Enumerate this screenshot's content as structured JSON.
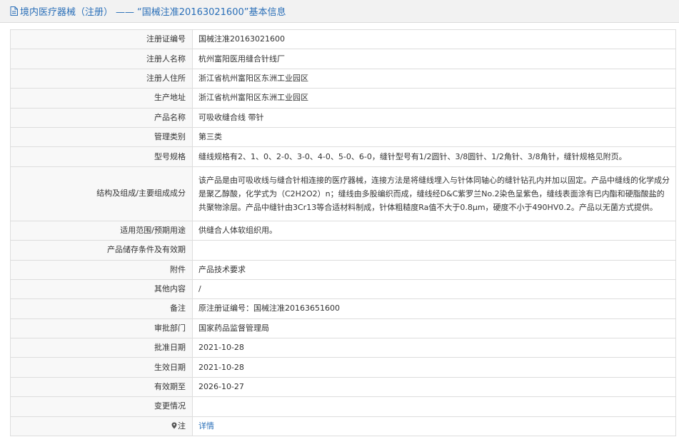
{
  "header": {
    "category": "境内医疗器械（注册）",
    "separator": "——",
    "reg_quoted": "“国械注准20163021600”",
    "suffix": "基本信息"
  },
  "rows": [
    {
      "label": "注册证编号",
      "value": "国械注准20163021600"
    },
    {
      "label": "注册人名称",
      "value": "杭州富阳医用缝合针线厂"
    },
    {
      "label": "注册人住所",
      "value": "浙江省杭州富阳区东洲工业园区"
    },
    {
      "label": "生产地址",
      "value": "浙江省杭州富阳区东洲工业园区"
    },
    {
      "label": "产品名称",
      "value": "可吸收缝合线 带针"
    },
    {
      "label": "管理类别",
      "value": "第三类"
    },
    {
      "label": "型号规格",
      "value": "缝线规格有2、1、0、2-0、3-0、4-0、5-0、6-0，缝针型号有1/2圆针、3/8圆针、1/2角针、3/8角针，缝针规格见附页。"
    },
    {
      "label": "结构及组成/主要组成成分",
      "value": "该产品是由可吸收线与缝合针相连接的医疗器械，连接方法是将缝线埋入与针体同轴心的缝针钻孔内并加以固定。产品中缝线的化学成分是聚乙醇酸，化学式为（C2H2O2）n；缝线由多股编织而成，缝线经D&C紫罗兰No.2染色呈紫色，缝线表面涂有已内酯和硬脂酸盐的共聚物涂层。产品中缝针由3Cr13等合适材料制成，针体粗糙度Ra值不大于0.8μm，硬度不小于490HV0.2。产品以无菌方式提供。"
    },
    {
      "label": "适用范围/预期用途",
      "value": "供缝合人体软组织用。"
    },
    {
      "label": "产品储存条件及有效期",
      "value": ""
    },
    {
      "label": "附件",
      "value": "产品技术要求"
    },
    {
      "label": "其他内容",
      "value": "/"
    },
    {
      "label": "备注",
      "value": "原注册证编号：国械注准20163651600"
    },
    {
      "label": "审批部门",
      "value": "国家药品监督管理局"
    },
    {
      "label": "批准日期",
      "value": "2021-10-28"
    },
    {
      "label": "生效日期",
      "value": "2021-10-28"
    },
    {
      "label": "有效期至",
      "value": "2026-10-27"
    },
    {
      "label": "变更情况",
      "value": ""
    }
  ],
  "note": {
    "label": "注",
    "link_text": "详情",
    "pin_icon": "location-pin-icon"
  },
  "colors": {
    "accent": "#2a6fb8",
    "header_bg": "#f2f2f2",
    "label_bg": "#f8f8f8",
    "border": "#dddddd"
  }
}
